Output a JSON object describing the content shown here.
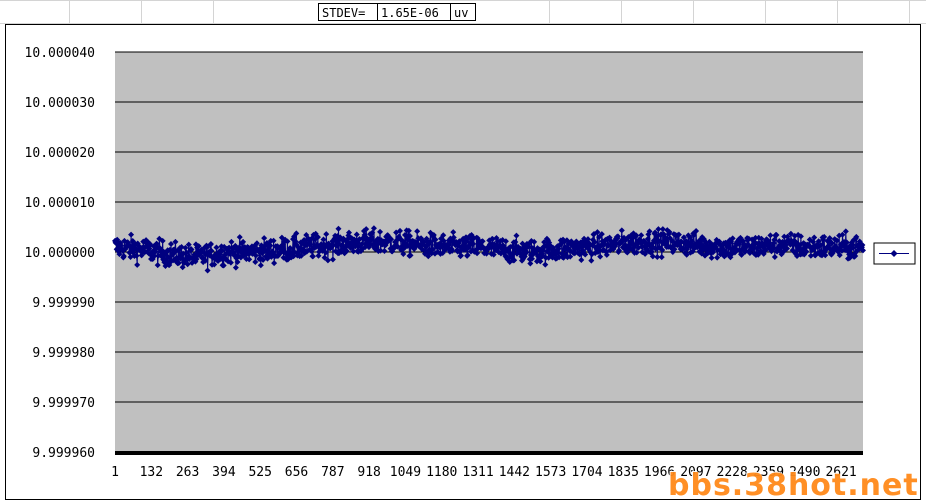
{
  "sheet": {
    "stdev_label": "STDEV=",
    "stdev_value": "1.65E-06",
    "stdev_unit": "uv"
  },
  "watermark": "bbs.38hot.net",
  "colors": {
    "plot_background": "#c0c0c0",
    "series": "#000080",
    "gridline": "#000000",
    "x_axis": "#000000"
  },
  "chart_data": {
    "type": "line",
    "title": "",
    "xlabel": "",
    "ylabel": "",
    "ylim": [
      9.99996,
      10.00004
    ],
    "y_ticks": [
      "10.000040",
      "10.000030",
      "10.000020",
      "10.000010",
      "10.000000",
      "9.999990",
      "9.999980",
      "9.999970",
      "9.999960"
    ],
    "x_tick_labels": [
      "1",
      "132",
      "263",
      "394",
      "525",
      "656",
      "787",
      "918",
      "1049",
      "1180",
      "1311",
      "1442",
      "1573",
      "1704",
      "1835",
      "1966",
      "2097",
      "2228",
      "2359",
      "2490",
      "2621"
    ],
    "grid": true,
    "legend": "right",
    "marker": "diamond",
    "series": [
      {
        "name": "",
        "x_range": [
          1,
          2700
        ],
        "mean": 10.0,
        "x": [
          1,
          100,
          200,
          300,
          400,
          500,
          600,
          700,
          800,
          900,
          1000,
          1100,
          1200,
          1300,
          1400,
          1500,
          1600,
          1700,
          1800,
          1900,
          2000,
          2100,
          2200,
          2300,
          2400,
          2500,
          2600,
          2700
        ],
        "values": [
          10.000001,
          10.0000005,
          9.9999995,
          9.999999,
          10.0,
          10.0,
          10.0000005,
          10.000001,
          10.0000015,
          10.000002,
          10.000002,
          10.0000015,
          10.000001,
          10.000001,
          10.0000005,
          10.0,
          10.0000005,
          10.000001,
          10.0000015,
          10.000002,
          10.000002,
          10.0000015,
          10.000001,
          10.000001,
          10.0000015,
          10.000001,
          10.000001,
          10.000001
        ],
        "stdev": 1.65e-06,
        "max_observed": 10.000007,
        "min_observed": 9.9999955
      }
    ]
  }
}
